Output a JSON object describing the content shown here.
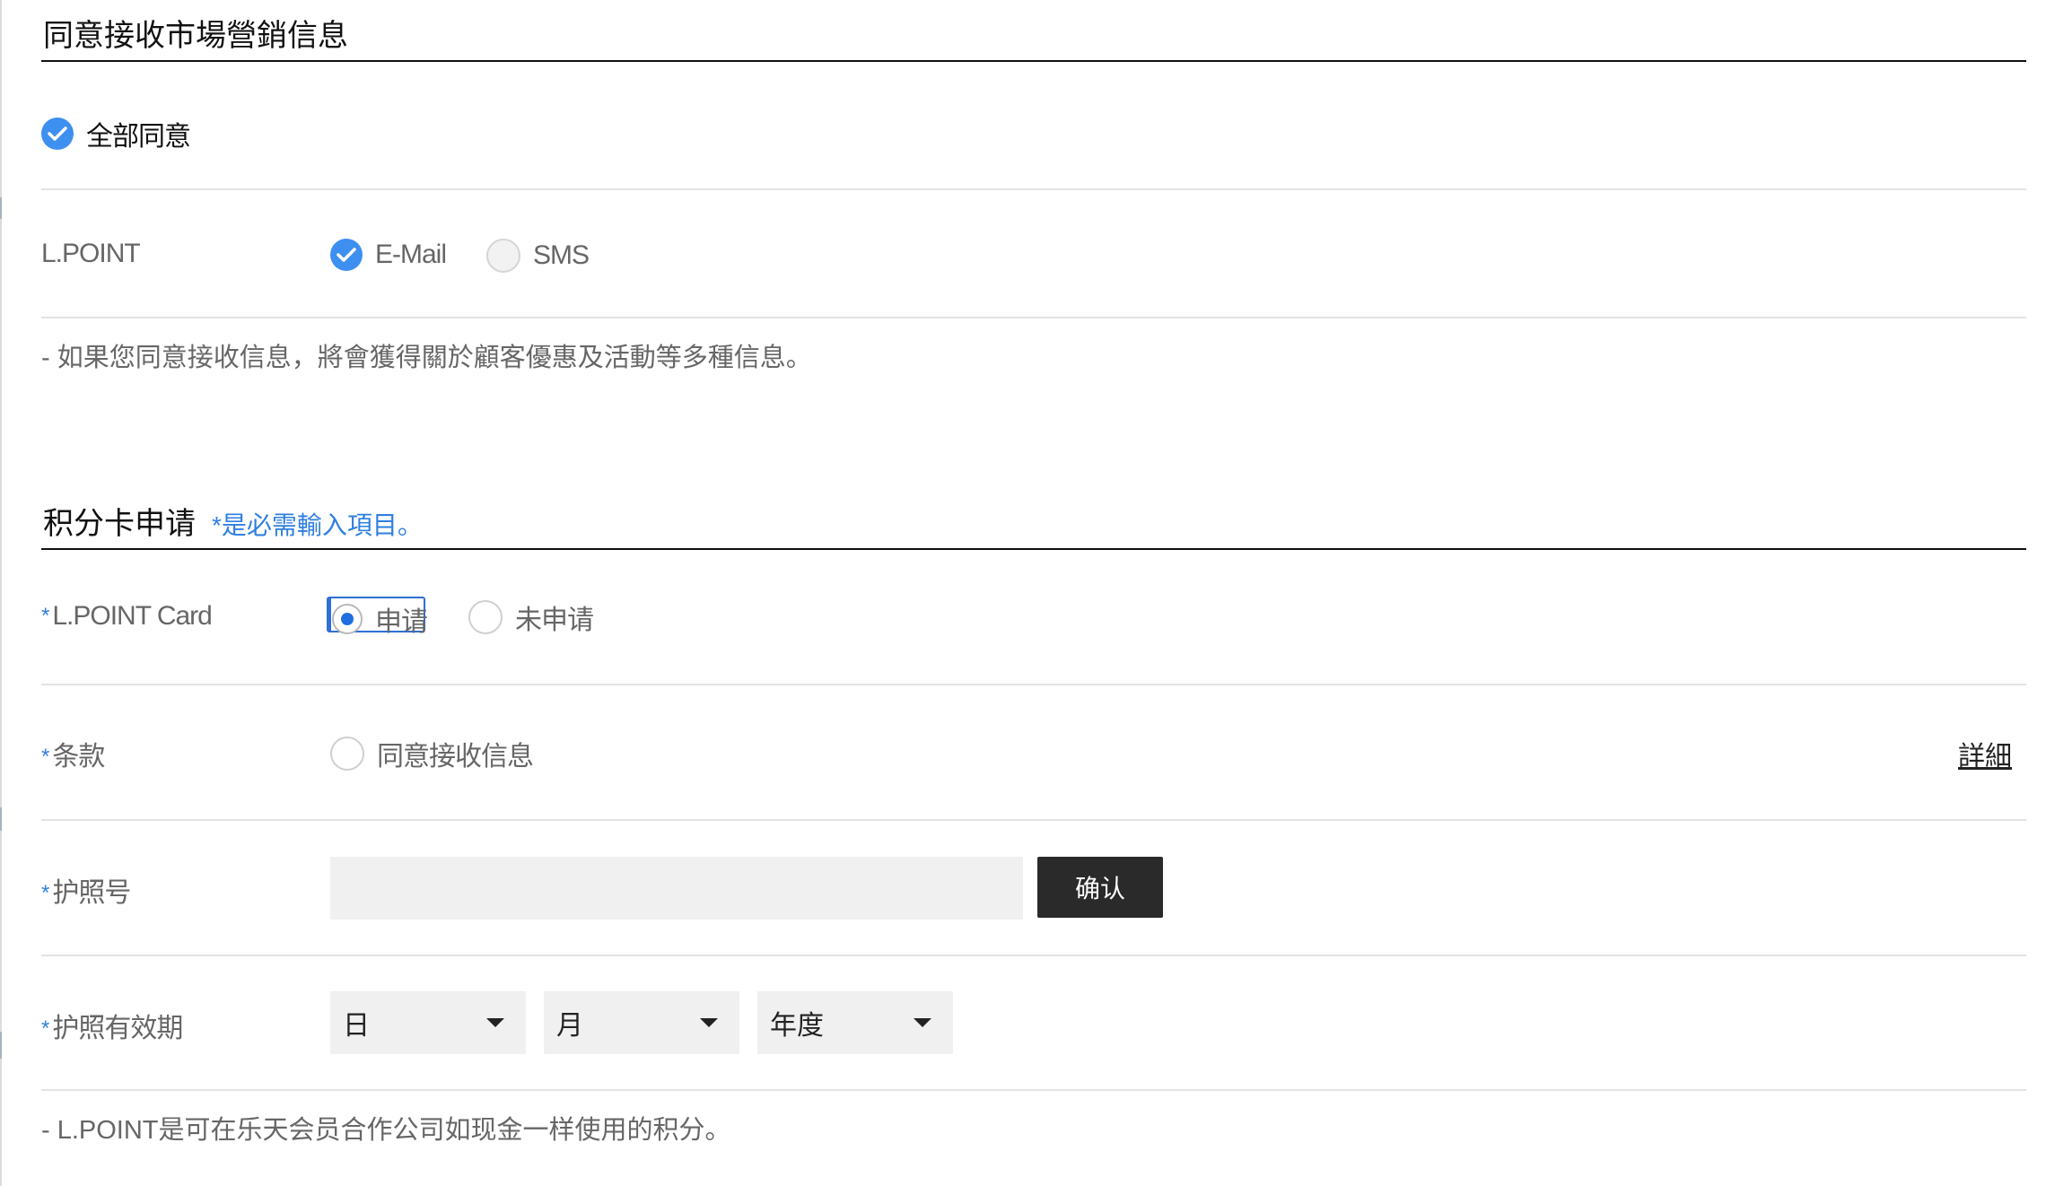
{
  "marketing": {
    "title": "同意接收市場營銷信息",
    "agree_all": "全部同意",
    "lpoint_label": "L.POINT",
    "email_label": "E-Mail",
    "sms_label": "SMS",
    "note": "- 如果您同意接收信息，將會獲得關於顧客優惠及活動等多種信息。"
  },
  "card": {
    "title": "积分卡申请",
    "required_note": "*是必需輸入項目。",
    "lpoint_card_label": "L.POINT Card",
    "apply_label": "申请",
    "not_apply_label": "未申请",
    "terms_label": "条款",
    "terms_agree_label": "同意接收信息",
    "detail_link": "詳細",
    "passport_label": "护照号",
    "passport_value": "",
    "confirm_button": "确认",
    "expiry_label": "护照有效期",
    "day_select": "日",
    "month_select": "月",
    "year_select": "年度",
    "footer_note": "- L.POINT是可在乐天会员合作公司如现金一样使用的积分。"
  },
  "required_mark": "*",
  "colors": {
    "accent": "#3d8ff0",
    "required": "#2f7fe0",
    "button": "#2a2a2a"
  }
}
